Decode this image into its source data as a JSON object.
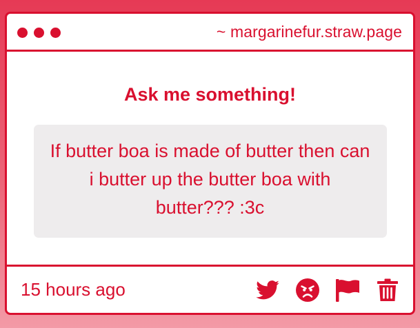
{
  "window": {
    "url": "~ margarinefur.straw.page"
  },
  "main": {
    "heading": "Ask me something!",
    "question": "If butter boa is made of butter then can i butter up the butter boa with butter??? :3c"
  },
  "footer": {
    "timestamp": "15 hours ago",
    "actions": [
      "twitter-icon",
      "angry-face-icon",
      "flag-icon",
      "trash-icon"
    ]
  },
  "colors": {
    "accent": "#d9102f",
    "card_bg": "#ffffff",
    "question_bg": "#eeeced",
    "page_bg_top": "#e63a55",
    "page_bg_bottom": "#f39aa6"
  }
}
